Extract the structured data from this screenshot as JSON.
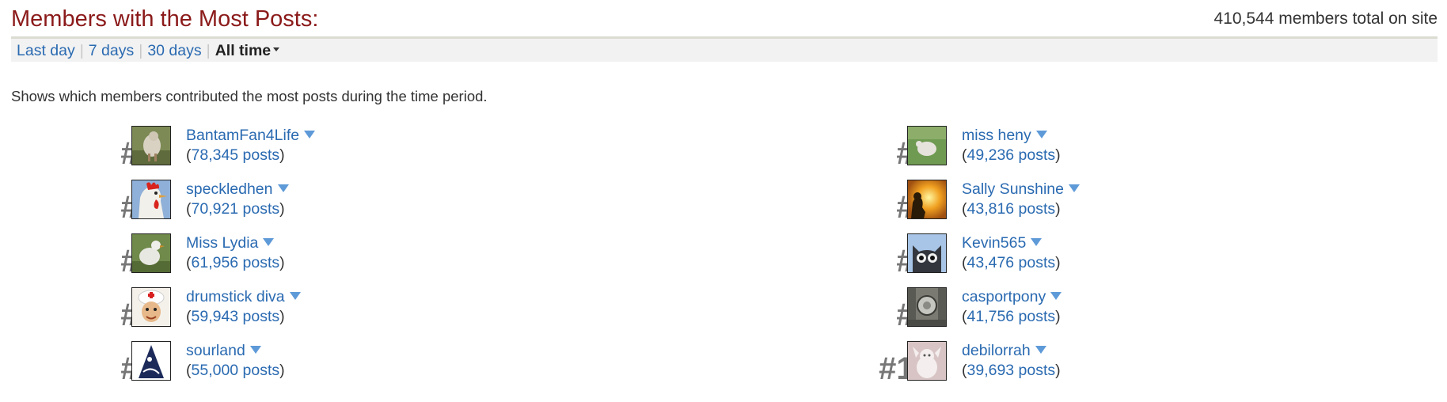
{
  "header": {
    "title": "Members with the Most Posts:",
    "total": "410,544 members total on site"
  },
  "tabs": {
    "last_day": "Last day",
    "seven_days": "7 days",
    "thirty_days": "30 days",
    "all_time": "All time",
    "separator": "|"
  },
  "description": "Shows which members contributed the most posts during the time period.",
  "members": [
    {
      "rank": "#1.",
      "name": "BantamFan4Life",
      "posts": "78,345 posts"
    },
    {
      "rank": "#2.",
      "name": "speckledhen",
      "posts": "70,921 posts"
    },
    {
      "rank": "#3.",
      "name": "Miss Lydia",
      "posts": "61,956 posts"
    },
    {
      "rank": "#4.",
      "name": "drumstick diva",
      "posts": "59,943 posts"
    },
    {
      "rank": "#5.",
      "name": "sourland",
      "posts": "55,000 posts"
    },
    {
      "rank": "#6.",
      "name": "miss heny",
      "posts": "49,236 posts"
    },
    {
      "rank": "#7.",
      "name": "Sally Sunshine",
      "posts": "43,816 posts"
    },
    {
      "rank": "#8.",
      "name": "Kevin565",
      "posts": "43,476 posts"
    },
    {
      "rank": "#9.",
      "name": "casportpony",
      "posts": "41,756 posts"
    },
    {
      "rank": "#10.",
      "name": "debilorrah",
      "posts": "39,693 posts"
    }
  ],
  "paren_open": "(",
  "paren_close": ")",
  "colors": {
    "title": "#8b1a1a",
    "link": "#2a6ab1",
    "rank": "#777777",
    "dropdown_caret": "#5e9ad8"
  }
}
